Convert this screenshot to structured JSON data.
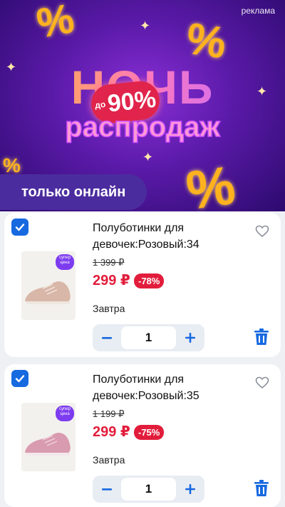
{
  "banner": {
    "ad_label": "реклама",
    "headline": "НОЧЬ",
    "discount_prefix": "до",
    "discount_value": "90%",
    "subline": "распродаж",
    "online_label": "только онлайн"
  },
  "cart_items": [
    {
      "title": "Полуботинки для девочек:Розовый:34",
      "old_price": "1 399 ₽",
      "price": "299 ₽",
      "discount": "-78%",
      "delivery": "Завтра",
      "quantity": "1",
      "sticker": "супер цена",
      "checked": true
    },
    {
      "title": "Полуботинки для девочек:Розовый:35",
      "old_price": "1 199 ₽",
      "price": "299 ₽",
      "discount": "-75%",
      "delivery": "Завтра",
      "quantity": "1",
      "sticker": "супер цена",
      "checked": true
    }
  ],
  "colors": {
    "accent_blue": "#1769e0",
    "price_red": "#e21d3c",
    "banner_purple": "#5a1aa8"
  },
  "icons": {
    "checkbox": "check-icon",
    "favorite": "heart-icon",
    "delete": "trash-icon",
    "decrease": "minus-icon",
    "increase": "plus-icon"
  }
}
